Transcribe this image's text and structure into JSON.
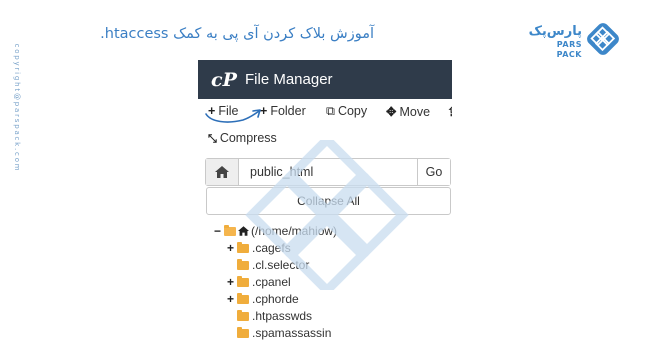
{
  "copyright": "copyright@parspack.com",
  "title": "آموزش بلاک کردن آی پی به کمک htaccess.",
  "brand": {
    "name_fa": "پارس‌پک",
    "name_en": "PARS PACK"
  },
  "file_manager": {
    "logo": "cP",
    "title": "File Manager",
    "toolbar": {
      "file": "File",
      "folder": "Folder",
      "copy": "Copy",
      "move": "Move",
      "compress": "Compress"
    },
    "path": {
      "value": "public_html",
      "go": "Go"
    },
    "collapse_all": "Collapse All",
    "tree": {
      "root": "(/home/mahiow)",
      "items": [
        {
          "name": ".cagefs",
          "expandable": true
        },
        {
          "name": ".cl.selector",
          "expandable": false
        },
        {
          "name": ".cpanel",
          "expandable": true
        },
        {
          "name": ".cphorde",
          "expandable": true
        },
        {
          "name": ".htpasswds",
          "expandable": false
        },
        {
          "name": ".spamassassin",
          "expandable": false
        }
      ]
    }
  },
  "colors": {
    "header_bg": "#2f3b4a",
    "accent": "#3b7fc4",
    "folder": "#f0ad3c",
    "watermark": "#c9ddf0"
  },
  "icons": [
    "plus-icon",
    "copy-icon",
    "move-icon",
    "compress-icon",
    "home-icon",
    "folder-icon",
    "folder-open-icon"
  ]
}
